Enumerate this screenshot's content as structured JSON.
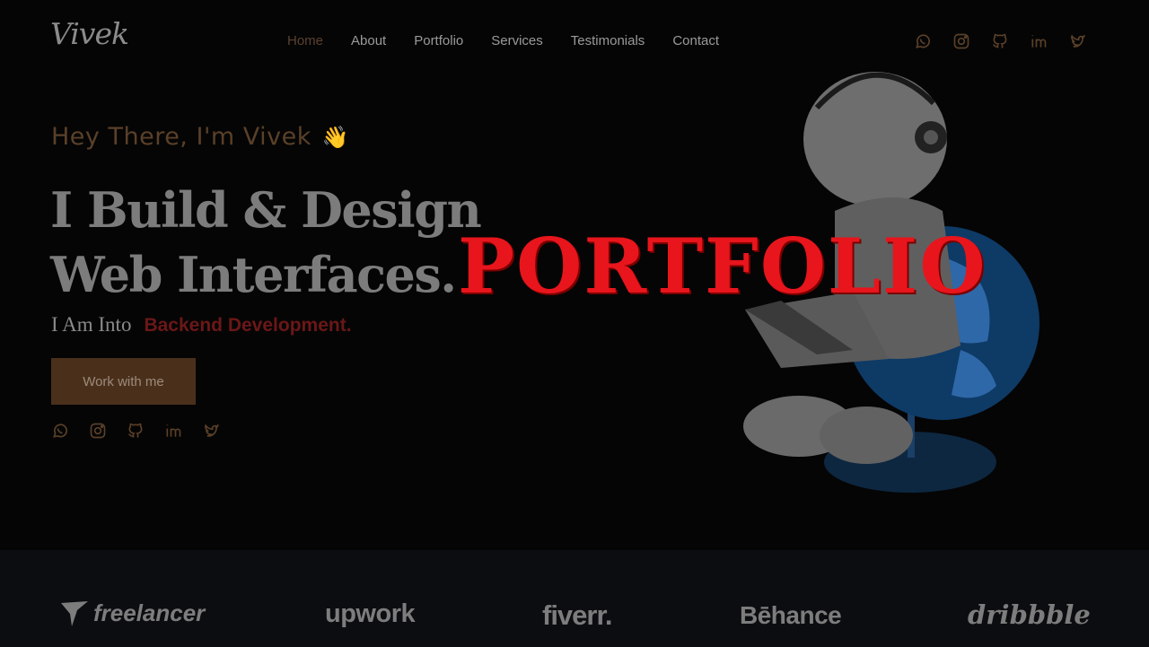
{
  "brand": {
    "logo": "Vivek"
  },
  "nav": {
    "items": [
      {
        "label": "Home",
        "active": true
      },
      {
        "label": "About"
      },
      {
        "label": "Portfolio"
      },
      {
        "label": "Services"
      },
      {
        "label": "Testimonials"
      },
      {
        "label": "Contact"
      }
    ],
    "social_icons": [
      "whatsapp-icon",
      "instagram-icon",
      "github-icon",
      "linkedin-icon",
      "twitter-icon"
    ]
  },
  "hero": {
    "greeting": "Hey There, I'm Vivek",
    "greeting_emoji": "👋",
    "headline_line1": "I Build & Design",
    "headline_line2": "Web Interfaces.",
    "subtitle_prefix": "I Am Into",
    "subtitle_role": "Backend Development.",
    "cta_label": "Work with me",
    "social_icons": [
      "whatsapp-icon",
      "instagram-icon",
      "github-icon",
      "linkedin-icon",
      "twitter-icon"
    ],
    "overlay_text": "PORTFOLIO"
  },
  "clients": {
    "logos": [
      "freelancer",
      "upwork",
      "fiverr.",
      "Bēhance",
      "dribbble"
    ]
  },
  "colors": {
    "background": "#050505",
    "accent_brown": "#4a301b",
    "overlay_red": "#e8151c",
    "role_red": "#6b1717"
  }
}
